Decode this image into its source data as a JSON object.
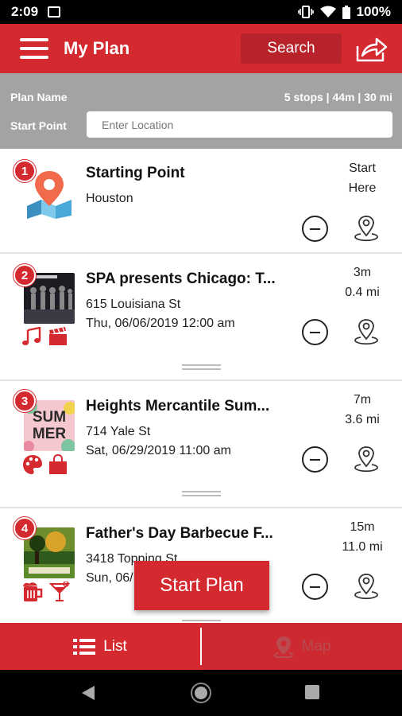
{
  "status_bar": {
    "time": "2:09",
    "battery": "100%"
  },
  "header": {
    "title": "My Plan",
    "search_label": "Search"
  },
  "plan": {
    "name_label": "Plan Name",
    "stats": "5 stops | 44m | 30 mi",
    "start_point_label": "Start Point",
    "location_placeholder": "Enter Location"
  },
  "stops": [
    {
      "number": "1",
      "title": "Starting Point",
      "line1": "Houston",
      "line2": "",
      "time": "Start",
      "distance": "Here"
    },
    {
      "number": "2",
      "title": "SPA presents Chicago: T...",
      "line1": "615 Louisiana St",
      "line2": "Thu, 06/06/2019 12:00 am",
      "time": "3m",
      "distance": "0.4 mi"
    },
    {
      "number": "3",
      "title": "Heights Mercantile Sum...",
      "line1": "714 Yale St",
      "line2": "Sat, 06/29/2019 11:00 am",
      "time": "7m",
      "distance": "3.6 mi",
      "thumb_text_1": "SUM",
      "thumb_text_2": "MER"
    },
    {
      "number": "4",
      "title": "Father's Day Barbecue F...",
      "line1": "3418 Topping St",
      "line2": "Sun, 06/16/2019",
      "time": "15m",
      "distance": "11.0 mi"
    }
  ],
  "fab": {
    "label": "Start Plan"
  },
  "bottom_nav": {
    "list_label": "List",
    "map_label": "Map"
  },
  "colors": {
    "primary": "#d42a2f",
    "primary_dark": "#b8222a",
    "plan_bar": "#a3a3a3"
  }
}
